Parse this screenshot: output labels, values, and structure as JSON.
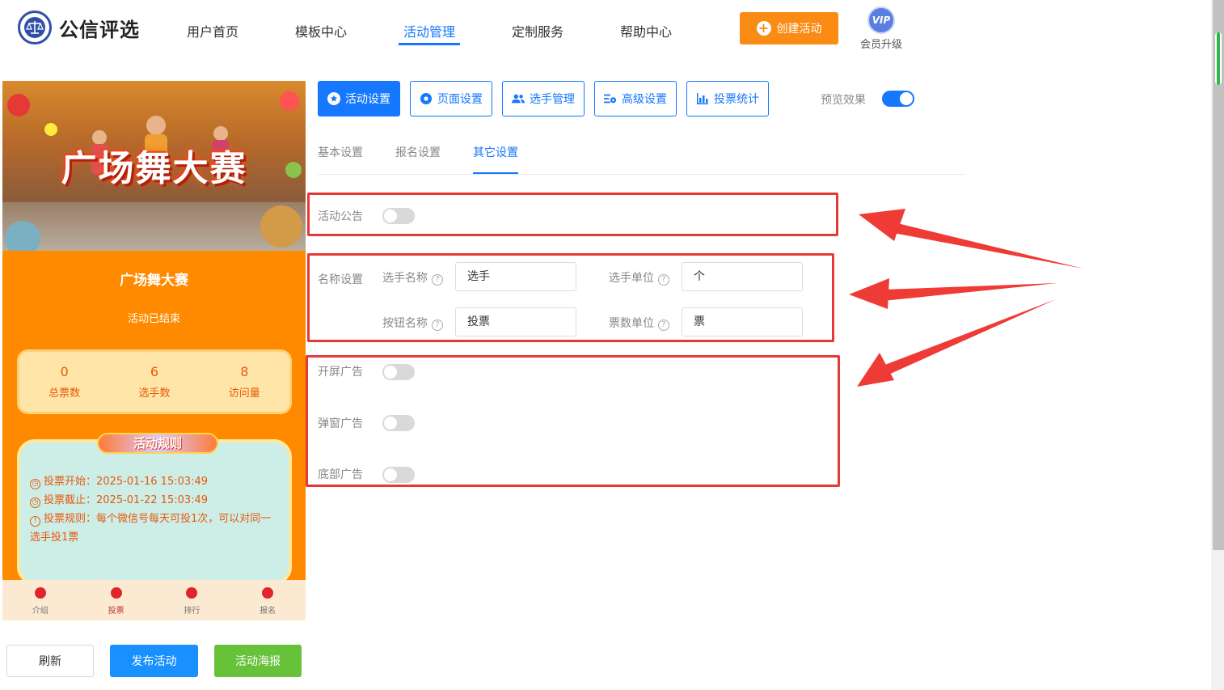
{
  "header": {
    "logo_text": "公信评选",
    "nav": [
      "用户首页",
      "模板中心",
      "活动管理",
      "定制服务",
      "帮助中心"
    ],
    "active_nav": "活动管理",
    "create_button": "创建活动",
    "vip_badge": "VIP",
    "vip_label": "会员升级"
  },
  "preview": {
    "banner_title": "广场舞大赛",
    "title": "广场舞大赛",
    "status": "活动已结束",
    "stats": [
      {
        "value": "0",
        "label": "总票数"
      },
      {
        "value": "6",
        "label": "选手数"
      },
      {
        "value": "8",
        "label": "访问量"
      }
    ],
    "rules_title": "活动规则",
    "rules": [
      "投票开始：2025-01-16 15:03:49",
      "投票截止：2025-01-22 15:03:49",
      "投票规则：每个微信号每天可投1次，可以对同一选手投1票"
    ],
    "tabs": [
      "介绍",
      "投票",
      "排行",
      "报名"
    ]
  },
  "actions": {
    "refresh": "刷新",
    "publish": "发布活动",
    "poster": "活动海报"
  },
  "toolbar": {
    "items": [
      "活动设置",
      "页面设置",
      "选手管理",
      "高级设置",
      "投票统计"
    ],
    "active": "活动设置",
    "preview_label": "预览效果",
    "preview_on": true
  },
  "subtabs": {
    "items": [
      "基本设置",
      "报名设置",
      "其它设置"
    ],
    "active": "其它设置"
  },
  "settings": {
    "announcement_label": "活动公告",
    "announcement_on": false,
    "naming_label": "名称设置",
    "player_name_label": "选手名称",
    "player_name_value": "选手",
    "player_unit_label": "选手单位",
    "player_unit_value": "个",
    "button_name_label": "按钮名称",
    "button_name_value": "投票",
    "vote_unit_label": "票数单位",
    "vote_unit_value": "票",
    "splash_ad_label": "开屏广告",
    "popup_ad_label": "弹窗广告",
    "bottom_ad_label": "底部广告",
    "splash_ad_on": false,
    "popup_ad_on": false,
    "bottom_ad_on": false
  },
  "colors": {
    "primary": "#1677ff",
    "orange": "#fa8c16",
    "highlight": "#e53935",
    "green": "#67c23a"
  }
}
